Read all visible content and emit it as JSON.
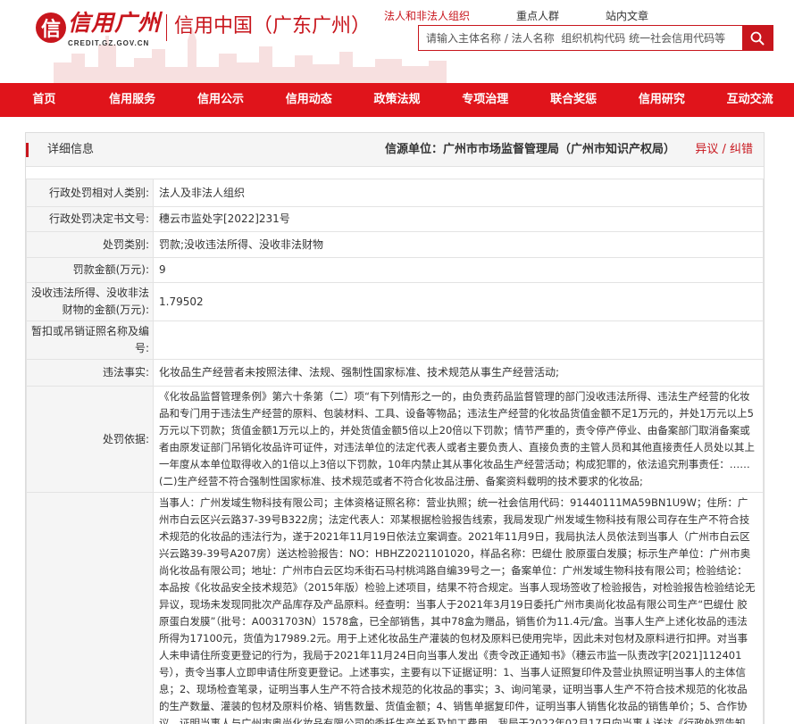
{
  "header": {
    "logo_cn": "信用广州",
    "logo_mark": "信",
    "logo_url": "CREDIT.GZ.GOV.CN",
    "site_sub": "信用中国（广东广州）",
    "top_links": [
      {
        "label": "法人和非法人组织",
        "active": true
      },
      {
        "label": "重点人群",
        "active": false
      },
      {
        "label": "站内文章",
        "active": false
      }
    ],
    "search_placeholder": "请输入主体名称 / 法人名称  组织机构代码 统一社会信用代码等"
  },
  "nav": [
    "首页",
    "信用服务",
    "信用公示",
    "信用动态",
    "政策法规",
    "专项治理",
    "联合奖惩",
    "信用研究",
    "互动交流"
  ],
  "detail": {
    "title": "详细信息",
    "source": "信源单位：广州市市场监督管理局（广州市知识产权局）",
    "error_link": "异议 / 纠错",
    "rows": [
      {
        "label": "行政处罚相对人类别:",
        "value": "法人及非法人组织"
      },
      {
        "label": "行政处罚决定书文号:",
        "value": "穗云市监处字[2022]231号"
      },
      {
        "label": "处罚类别:",
        "value": "罚款;没收违法所得、没收非法财物"
      },
      {
        "label": "罚款金额(万元):",
        "value": "9"
      },
      {
        "label": "没收违法所得、没收非法财物的金额(万元):",
        "value": "1.79502"
      },
      {
        "label": "暂扣或吊销证照名称及编号:",
        "value": ""
      },
      {
        "label": "违法事实:",
        "value": "化妆品生产经营者未按照法律、法规、强制性国家标准、技术规范从事生产经营活动;"
      },
      {
        "label": "处罚依据:",
        "value": "《化妆品监督管理条例》第六十条第（二）项“有下列情形之一的，由负责药品监督管理的部门没收违法所得、违法生产经营的化妆品和专门用于违法生产经营的原料、包装材料、工具、设备等物品；违法生产经营的化妆品货值金额不足1万元的，并处1万元以上5万元以下罚款；货值金额1万元以上的，并处货值金额5倍以上20倍以下罚款；情节严重的，责令停产停业、由备案部门取消备案或者由原发证部门吊销化妆品许可证件，对违法单位的法定代表人或者主要负责人、直接负责的主管人员和其他直接责任人员处以其上一年度从本单位取得收入的1倍以上3倍以下罚款，10年内禁止其从事化妆品生产经营活动；构成犯罪的，依法追究刑事责任：……(二)生产经营不符合强制性国家标准、技术规范或者不符合化妆品注册、备案资料载明的技术要求的化妆品;"
      },
      {
        "label": "",
        "value": "当事人：广州发域生物科技有限公司；主体资格证照名称：营业执照；统一社会信用代码：91440111MA59BN1U9W；住所：广州市白云区兴云路37-39号B322房；法定代表人：邓某根据检验报告线索，我局发现广州发域生物科技有限公司存在生产不符合技术规范的化妆品的违法行为，遂于2021年11月19日依法立案调查。2021年11月9日，我局执法人员依法到当事人（广州市白云区兴云路39-39号A207房）送达检验报告：NO：HBHZ2021101020，样品名称：巴缇仕 胶原蛋白发膜；标示生产单位：广州市奥尚化妆品有限公司；地址：广州市白云区均禾街石马村桃鸿路自编39号之一；备案单位：广州发域生物科技有限公司；检验结论：本品按《化妆品安全技术规范》（2015年版）检验上述项目，结果不符合规定。当事人现场签收了检验报告，对检验报告检验结论无异议，现场未发现同批次产品库存及产品原料。经查明：当事人于2021年3月19日委托广州市奥尚化妆品有限公司生产“巴缇仕 胶原蛋白发膜”（批号：A0031703N）1578盒，已全部销售，其中78盒为赠品，销售价为11.4元/盒。当事人生产上述化妆品的违法所得为17100元，货值为17989.2元。用于上述化妆品生产灌装的包材及原料已使用完毕，因此未对包材及原料进行扣押。对当事人未申请住所变更登记的行为，我局于2021年11月24日向当事人发出《责令改正通知书》（穗云市监一队责改字[2021]112401号），责令当事人立即申请住所变更登记。上述事实，主要有以下证据证明：1、当事人证照复印件及营业执照证明当事人的主体信息；2、现场检查笔录，证明当事人生产不符合技术规范的化妆品的事实；3、询问笔录，证明当事人生产不符合技术规范的化妆品的生产数量、灌装的包材及原料价格、销售数量、货值金额；4、销售单据复印件，证明当事人销售化妆品的销售单价；5、合作协议，证明当事人与广州市奥尚化妆品有限公司的委托生产关系及加工费用。我局于2022年02月17日向当事人送达《行政处罚告知书》，依法告知当事人我局拟作出行政处罚的事实、理由、依据和内容，并告知当事人依法享有提出陈述、申"
      }
    ]
  }
}
